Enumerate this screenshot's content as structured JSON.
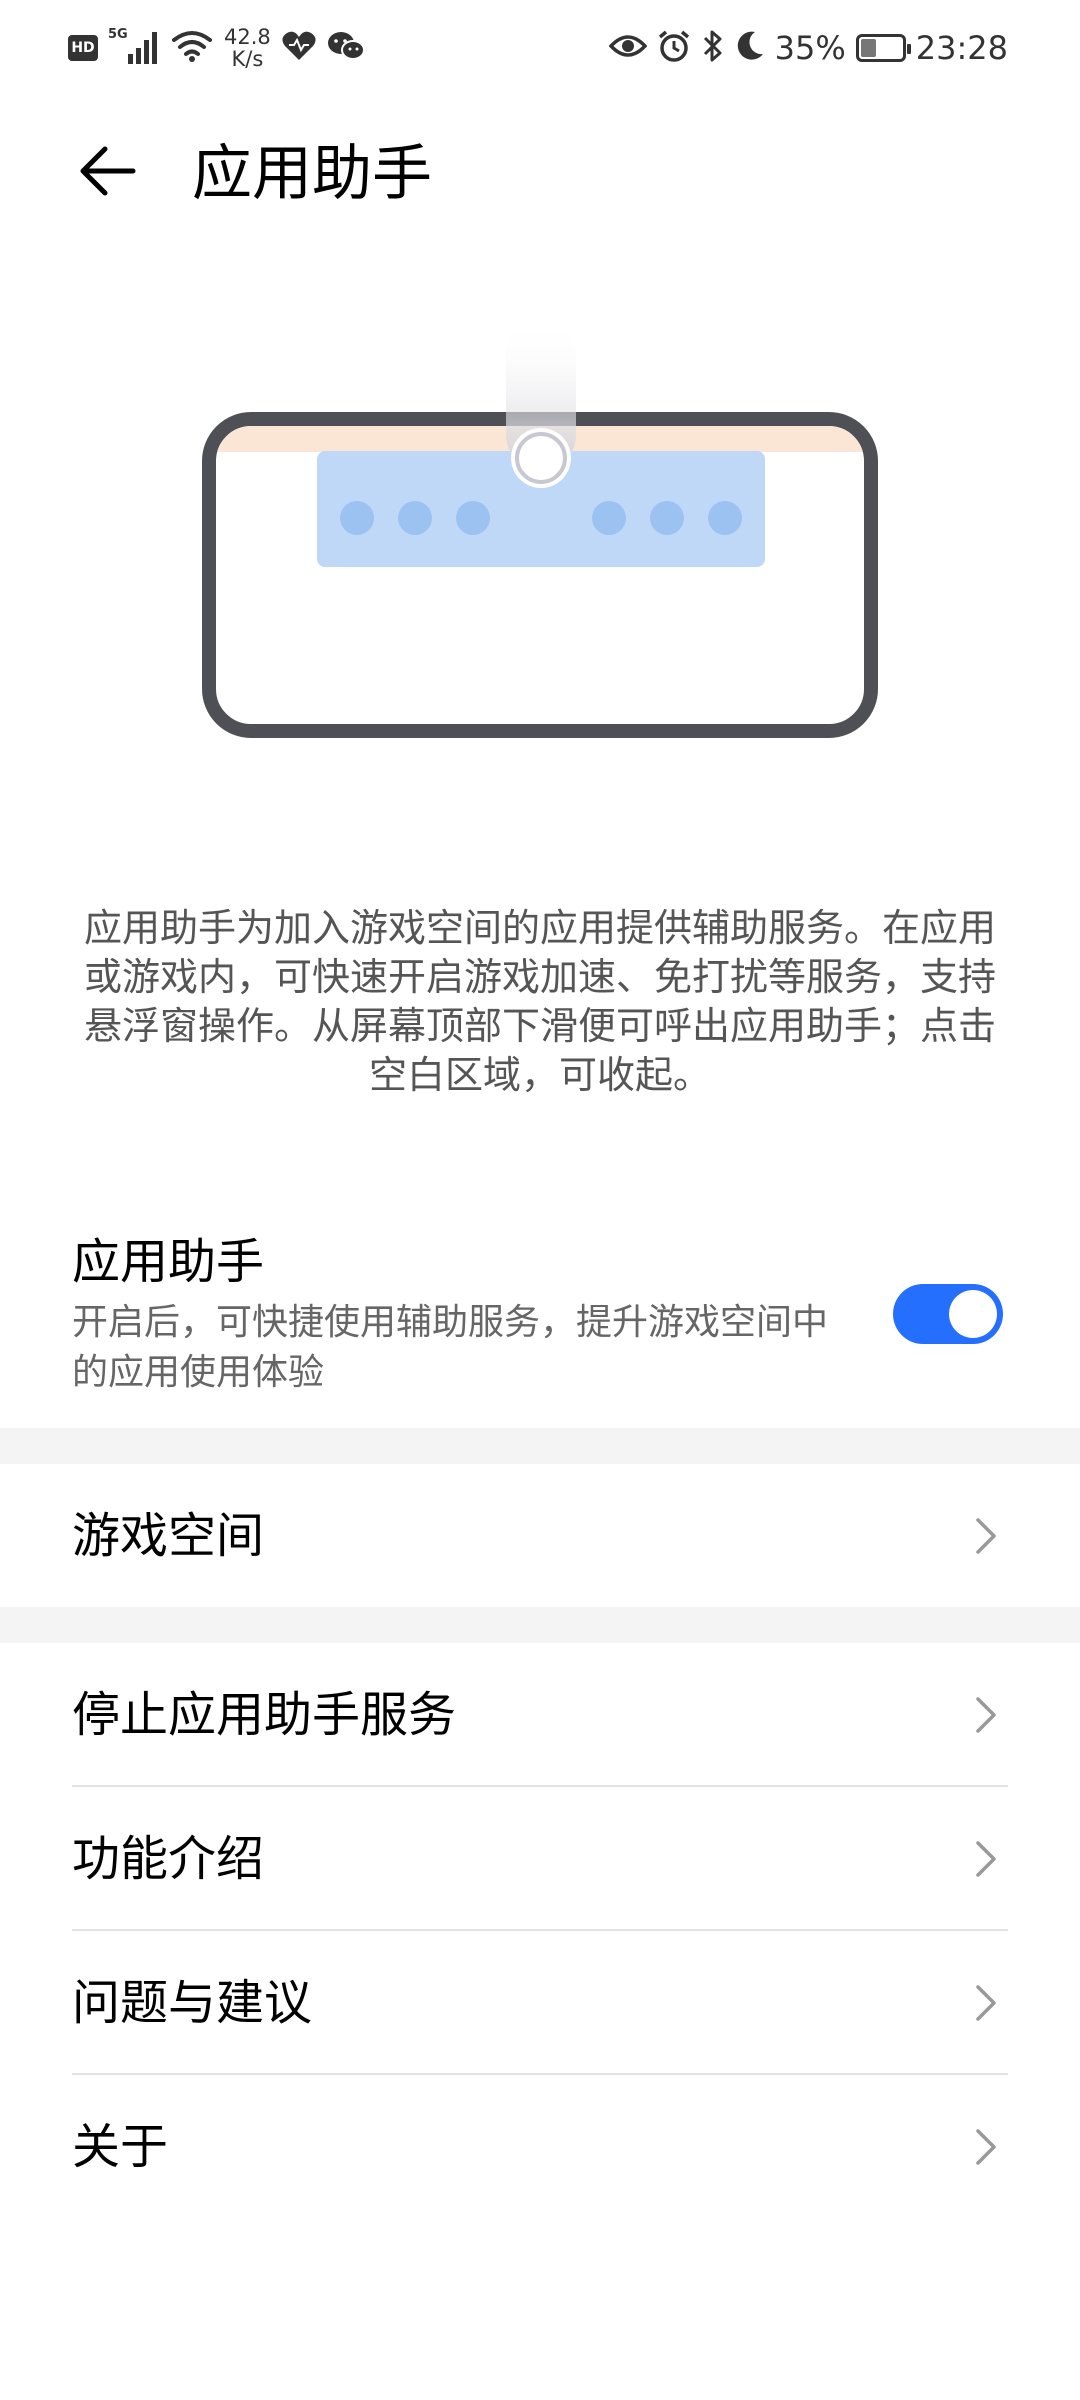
{
  "status_bar": {
    "hd_badge": "HD",
    "network": "5G",
    "net_speed_value": "42.8",
    "net_speed_unit": "K/s",
    "battery": "35%",
    "battery_level": 0.35,
    "time": "23:28",
    "icons": [
      "hd-icon",
      "signal-icon",
      "wifi-icon",
      "health-heart-icon",
      "wechat-icon",
      "eye-icon",
      "alarm-icon",
      "bluetooth-icon",
      "moon-icon",
      "battery-icon"
    ]
  },
  "header": {
    "title": "应用助手",
    "back_icon": "back-arrow-icon"
  },
  "description": "应用助手为加入游戏空间的应用提供辅助服务。在应用或游戏内，可快速开启游戏加速、免打扰等服务，支持悬浮窗操作。从屏幕顶部下滑便可呼出应用助手；点击空白区域，可收起。",
  "toggle": {
    "title": "应用助手",
    "subtitle": "开启后，可快捷使用辅助服务，提升游戏空间中的应用使用体验",
    "enabled": true,
    "color": "#256FFF"
  },
  "list": {
    "game_space": "游戏空间",
    "stop_service": "停止应用助手服务",
    "features": "功能介绍",
    "feedback": "问题与建议",
    "about": "关于"
  },
  "colors": {
    "accent": "#256FFF",
    "illustration_blue": "#BFD8F8",
    "illustration_dot": "#9CC2F2",
    "illustration_peach": "#FBE6D6",
    "frame": "#4F5056"
  }
}
